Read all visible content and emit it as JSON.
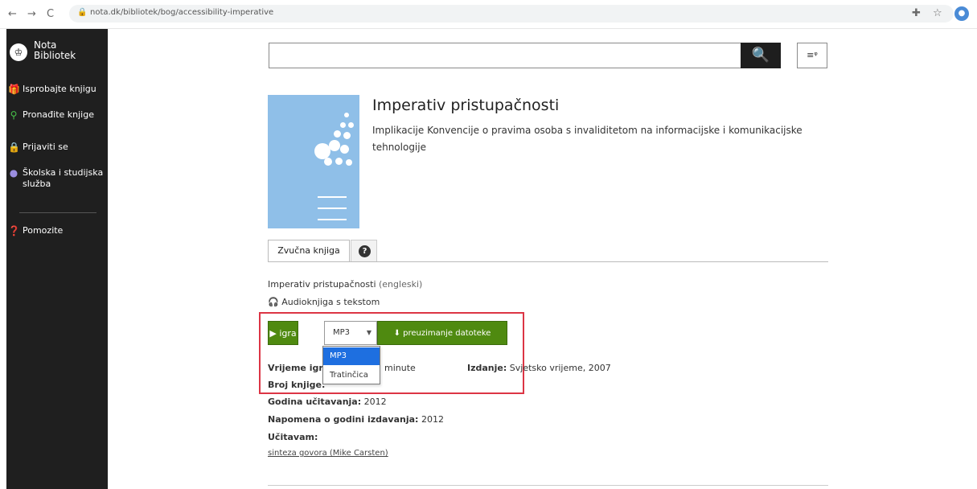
{
  "browser": {
    "url": "nota.dk/bibliotek/bog/accessibility-imperative",
    "back_icon": "←",
    "forward_icon": "→",
    "reload_icon": "C",
    "lock_icon": "🔒",
    "translate_icon": "✚",
    "star_icon": "☆",
    "profile_icon": "●"
  },
  "sidebar": {
    "brand": "Nota Bibliotek",
    "items": [
      {
        "label": "Isprobajte knjigu",
        "icon": "gift-icon"
      },
      {
        "label": "Pronađite knjige",
        "icon": "search-icon"
      },
      {
        "label": "Prijaviti se",
        "icon": "lock-icon"
      },
      {
        "label": "Školska i studijska služba",
        "icon": "circle-icon"
      },
      {
        "label": "Pomozite",
        "icon": "help-icon"
      }
    ]
  },
  "search": {
    "value": "",
    "button_icon": "🔍",
    "advanced_icon": "≡ᵠ"
  },
  "book": {
    "title": "Imperativ pristupačnosti",
    "subtitle": "Implikacije Konvencije o pravima osoba s invaliditetom na informacijske i komunikacijske tehnologije"
  },
  "tabs": {
    "audio": "Zvučna knjiga",
    "help": "?"
  },
  "details": {
    "work_title": "Imperativ pristupačnosti",
    "language": "(engleski)",
    "audio_type": "Audioknjiga s tekstom",
    "play_label": "igra",
    "format_selected": "MP3",
    "download_label": "preuzimanje datoteke",
    "format_options": [
      "MP3",
      "Tratinčica"
    ],
    "playtime_label": "Vrijeme igr",
    "playtime_value": "minute",
    "edition_label": "Izdanje:",
    "edition_value": "Svjetsko vrijeme, 2007",
    "book_number_label": "Broj knjige:",
    "upload_year_label": "Godina učitavanja:",
    "upload_year_value": "2012",
    "publish_note_label": "Napomena o godini izdavanja:",
    "publish_note_value": "2012",
    "reader_label": "Učitavam:",
    "reader_value": "sinteza govora (Mike Carsten)"
  },
  "colors": {
    "sidebar": "#1f1f1f",
    "green_button": "#4f8a10",
    "highlight": "#dc3545",
    "cover": "#8fbfe8",
    "selected_option": "#1e6fe0"
  }
}
